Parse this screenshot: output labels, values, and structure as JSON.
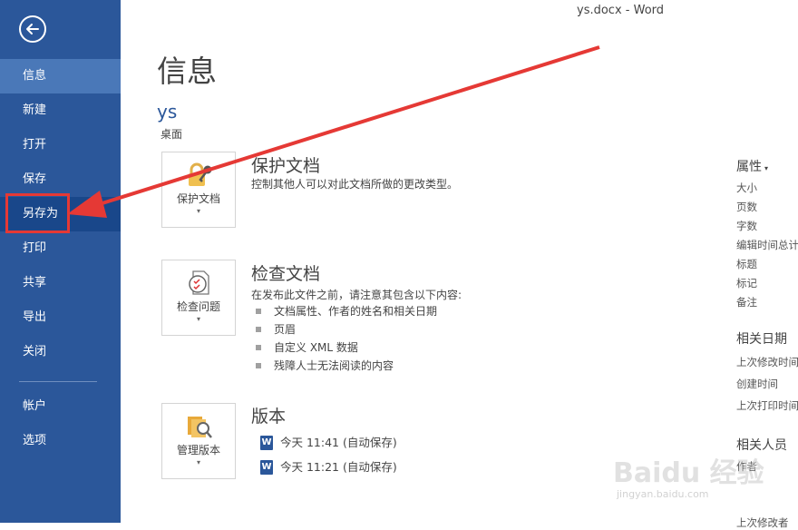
{
  "window": {
    "title": "ys.docx - Word"
  },
  "sidebar": {
    "back_icon": "back-arrow-icon",
    "items": [
      {
        "label": "信息",
        "state": "active"
      },
      {
        "label": "新建"
      },
      {
        "label": "打开"
      },
      {
        "label": "保存"
      },
      {
        "label": "另存为",
        "state": "hover"
      },
      {
        "label": "打印"
      },
      {
        "label": "共享"
      },
      {
        "label": "导出"
      },
      {
        "label": "关闭"
      },
      {
        "label": "帐户"
      },
      {
        "label": "选项"
      }
    ]
  },
  "main": {
    "title": "信息",
    "doc_name": "ys",
    "doc_path": "桌面",
    "sections": [
      {
        "tile_label": "保护文档",
        "icon": "lock-key-icon",
        "title": "保护文档",
        "desc": "控制其他人可以对此文档所做的更改类型。"
      },
      {
        "tile_label": "检查问题",
        "icon": "inspect-document-icon",
        "title": "检查文档",
        "desc": "在发布此文件之前，请注意其包含以下内容:",
        "bullets": [
          "文档属性、作者的姓名和相关日期",
          "页眉",
          "自定义 XML 数据",
          "残障人士无法阅读的内容"
        ]
      },
      {
        "tile_label": "管理版本",
        "icon": "manage-versions-icon",
        "title": "版本",
        "versions": [
          "今天 11:41 (自动保存)",
          "今天 11:21 (自动保存)"
        ]
      }
    ]
  },
  "properties": {
    "header": "属性",
    "items": [
      "大小",
      "页数",
      "字数",
      "编辑时间总计",
      "标题",
      "标记",
      "备注"
    ],
    "dates_header": "相关日期",
    "dates": [
      "上次修改时间",
      "创建时间",
      "上次打印时间"
    ],
    "people_header": "相关人员",
    "people": [
      "作者",
      "上次修改者"
    ]
  },
  "watermark": {
    "main": "Baidu 经验",
    "sub": "jingyan.baidu.com"
  },
  "colors": {
    "sidebar": "#2b579a",
    "active": "#4a78b8",
    "accent": "#2b579a",
    "annotation": "#e53935"
  }
}
